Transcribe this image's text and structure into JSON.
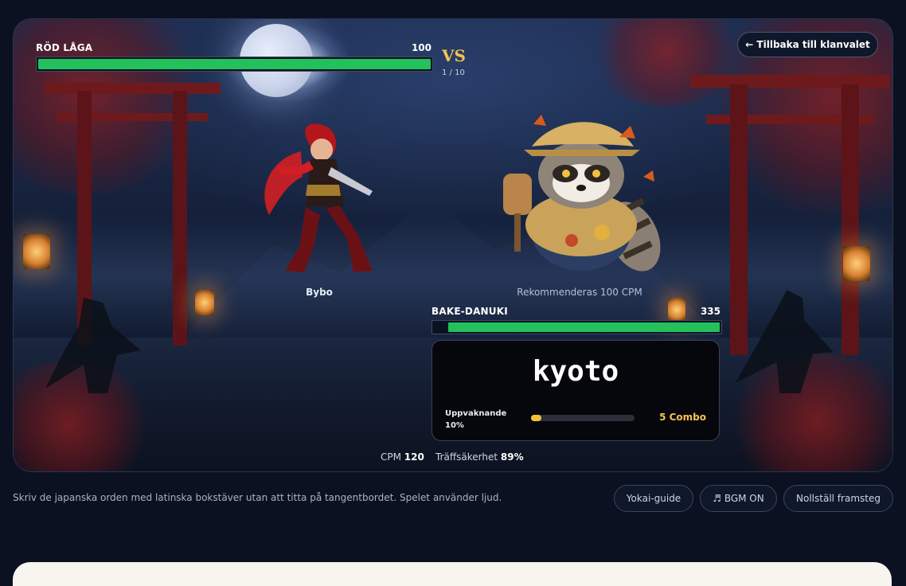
{
  "player": {
    "name": "RÖD LÅGA",
    "hp": 100,
    "hp_fraction": 1.0,
    "character_name": "Bybo"
  },
  "vs": {
    "label": "VS",
    "round": "1 / 10"
  },
  "enemy": {
    "name": "BAKE-DANUKI",
    "hp": 335,
    "hp_fraction": 0.95,
    "recommendation": "Rekommenderas 100 CPM"
  },
  "back_button": {
    "label": "← Tillbaka till klanvalet"
  },
  "typing": {
    "word": "kyoto",
    "rank_label": "Uppvaknande",
    "rank_percent": "10%",
    "progress_fraction": 0.1,
    "combo": "5 Combo"
  },
  "stats": {
    "cpm_label": "CPM",
    "cpm_value": "120",
    "accuracy_label": "Träffsäkerhet",
    "accuracy_value": "89%"
  },
  "footer": {
    "hint": "Skriv de japanska orden med latinska bokstäver utan att titta på tangentbordet. Spelet använder ljud.",
    "buttons": {
      "guide": "Yokai-guide",
      "bgm": "♬ BGM ON",
      "reset": "Nollställ framsteg"
    }
  },
  "colors": {
    "hp": "#24c05b",
    "accent": "#f4c250",
    "progress": "#f4c030",
    "background": "#0b1120"
  }
}
